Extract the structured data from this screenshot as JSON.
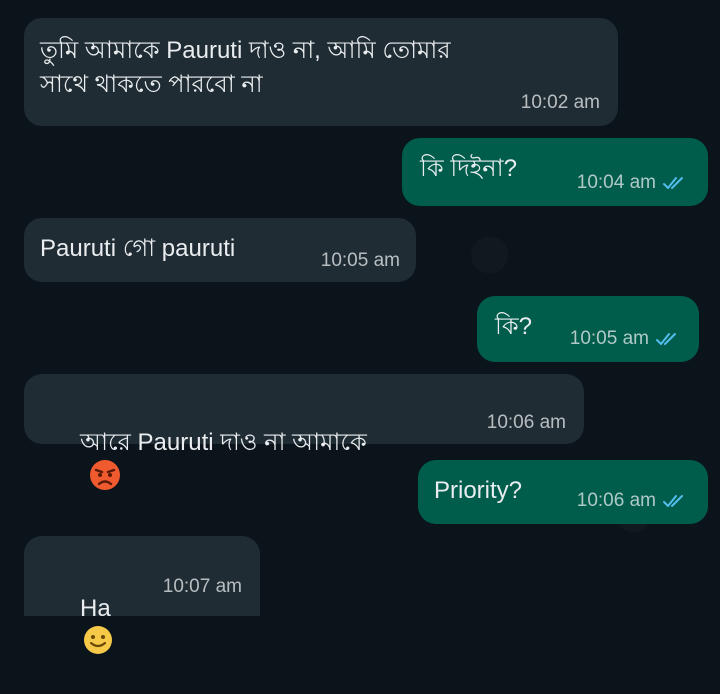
{
  "messages": [
    {
      "direction": "in",
      "text": "তুমি আমাকে Pauruti দাও না, আমি তোমার\nসাথে থাকতে পারবো না",
      "time": "10:02 am"
    },
    {
      "direction": "out",
      "text": "কি দিইনা?",
      "time": "10:04 am",
      "status_icon": "double-check-icon"
    },
    {
      "direction": "in",
      "text": "Pauruti গো pauruti",
      "time": "10:05 am"
    },
    {
      "direction": "out",
      "text": "কি?",
      "time": "10:05 am",
      "status_icon": "double-check-icon"
    },
    {
      "direction": "in",
      "text": "আরে Pauruti দাও না আমাকে",
      "emoji": "angry-face-emoji",
      "time": "10:06 am"
    },
    {
      "direction": "out",
      "text": "Priority?",
      "time": "10:06 am",
      "status_icon": "double-check-icon"
    },
    {
      "direction": "in",
      "text": "Ha",
      "emoji": "slightly-smiling-face-emoji",
      "time": "10:07 am"
    }
  ],
  "colors": {
    "background": "#0b141a",
    "incoming_bubble": "#202c33",
    "outgoing_bubble": "#005c4b",
    "read_ticks": "#53bdeb"
  }
}
